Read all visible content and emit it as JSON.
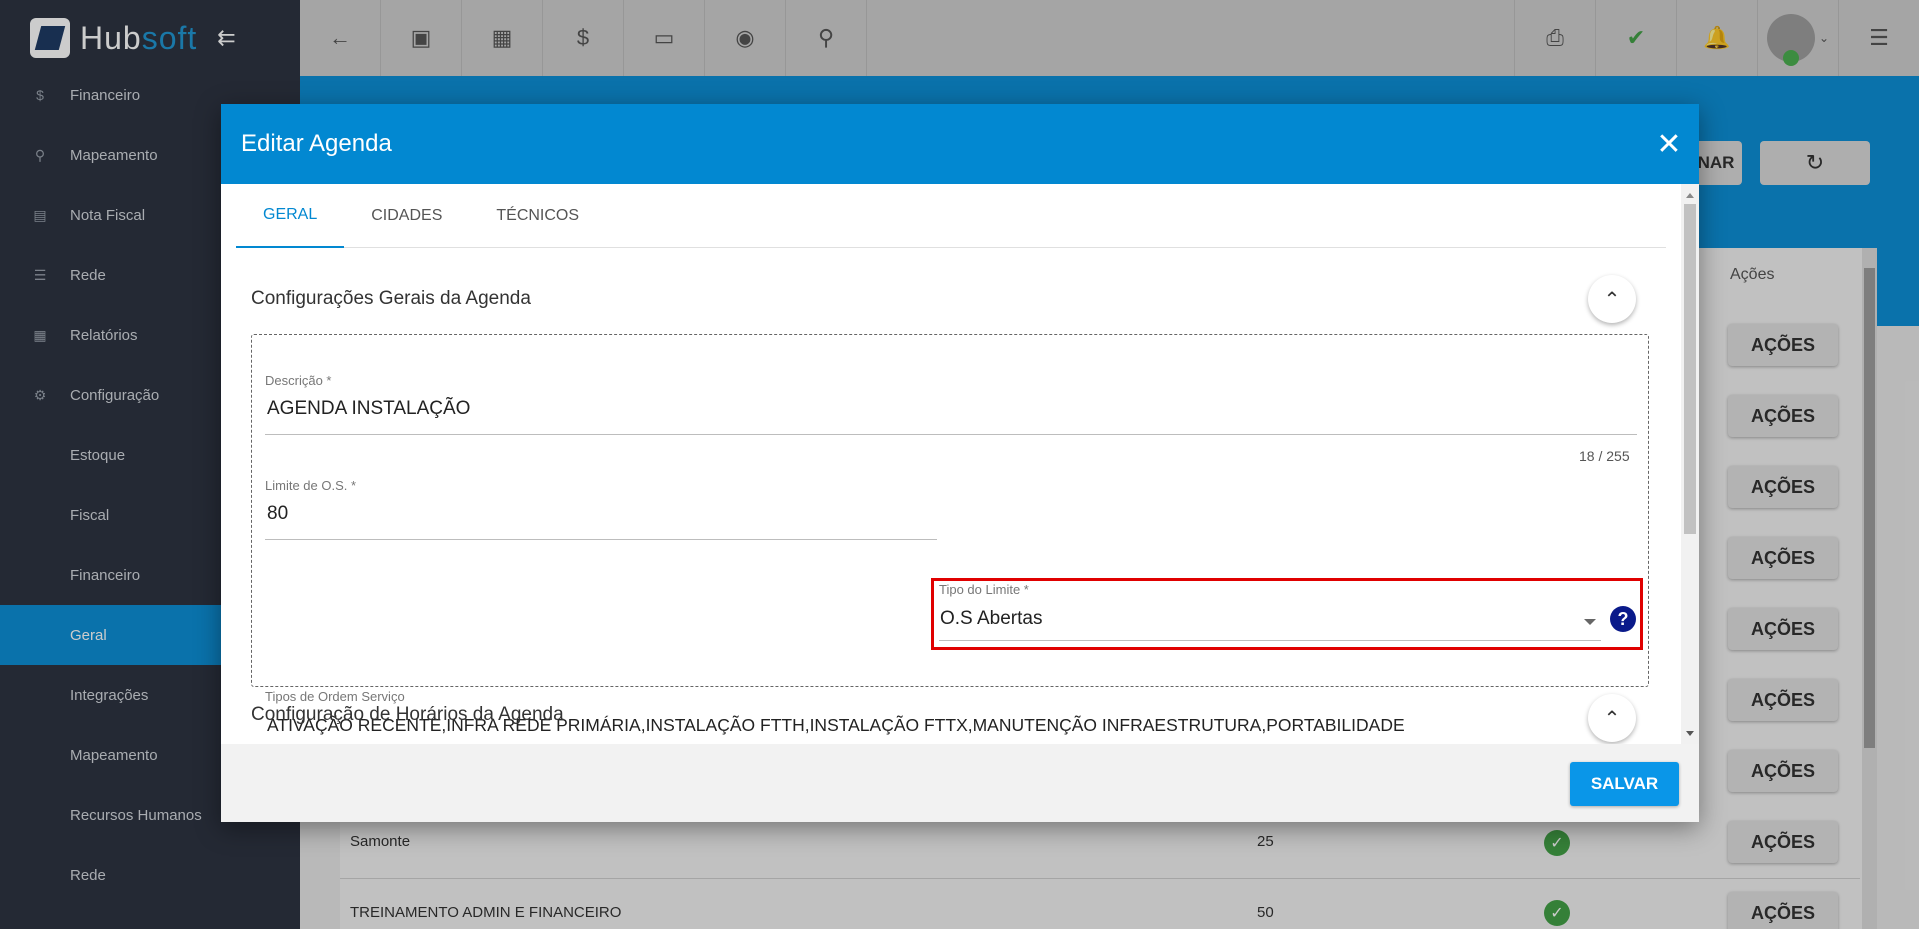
{
  "app": {
    "logo_text_a": "Hub",
    "logo_text_b": "soft"
  },
  "sidebar": {
    "items": [
      {
        "label": "Financeiro",
        "icon": "dollar-icon"
      },
      {
        "label": "Mapeamento",
        "icon": "map-pin-icon"
      },
      {
        "label": "Nota Fiscal",
        "icon": "receipt-icon"
      },
      {
        "label": "Rede",
        "icon": "server-icon"
      },
      {
        "label": "Relatórios",
        "icon": "document-icon"
      },
      {
        "label": "Configuração",
        "icon": "gear-icon"
      }
    ],
    "subitems": [
      {
        "label": "Estoque"
      },
      {
        "label": "Fiscal"
      },
      {
        "label": "Financeiro"
      },
      {
        "label": "Geral",
        "active": true
      },
      {
        "label": "Integrações"
      },
      {
        "label": "Mapeamento"
      },
      {
        "label": "Recursos Humanos"
      },
      {
        "label": "Rede"
      }
    ]
  },
  "background": {
    "btn_nar": "NAR",
    "col_acoes": "Ações",
    "row_action_label": "AÇÕES",
    "rows": [
      {
        "name": "Samonte",
        "value": "25"
      },
      {
        "name": "TREINAMENTO ADMIN E FINANCEIRO",
        "value": "50"
      }
    ]
  },
  "modal": {
    "title": "Editar Agenda",
    "tabs": [
      "GERAL",
      "CIDADES",
      "TÉCNICOS"
    ],
    "section1_title": "Configurações Gerais da Agenda",
    "section2_title": "Configuração de Horários da Agenda",
    "fields": {
      "descricao_label": "Descrição *",
      "descricao_value": "AGENDA INSTALAÇÃO",
      "descricao_counter": "18 / 255",
      "limite_label": "Limite de O.S. *",
      "limite_value": "80",
      "tipo_limite_label": "Tipo do Limite *",
      "tipo_limite_value": "O.S Abertas",
      "tipos_os_label": "Tipos de Ordem Serviço",
      "tipos_os_value": "ATIVAÇÃO RECENTE,INFRA REDE PRIMÁRIA,INSTALAÇÃO FTTH,INSTALAÇÃO FTTX,MANUTENÇÃO INFRAESTRUTURA,PORTABILIDADE"
    },
    "save_label": "SALVAR"
  },
  "colors": {
    "accent": "#0288d1",
    "sidebar_bg": "#2d3441",
    "highlight": "#e00000"
  }
}
